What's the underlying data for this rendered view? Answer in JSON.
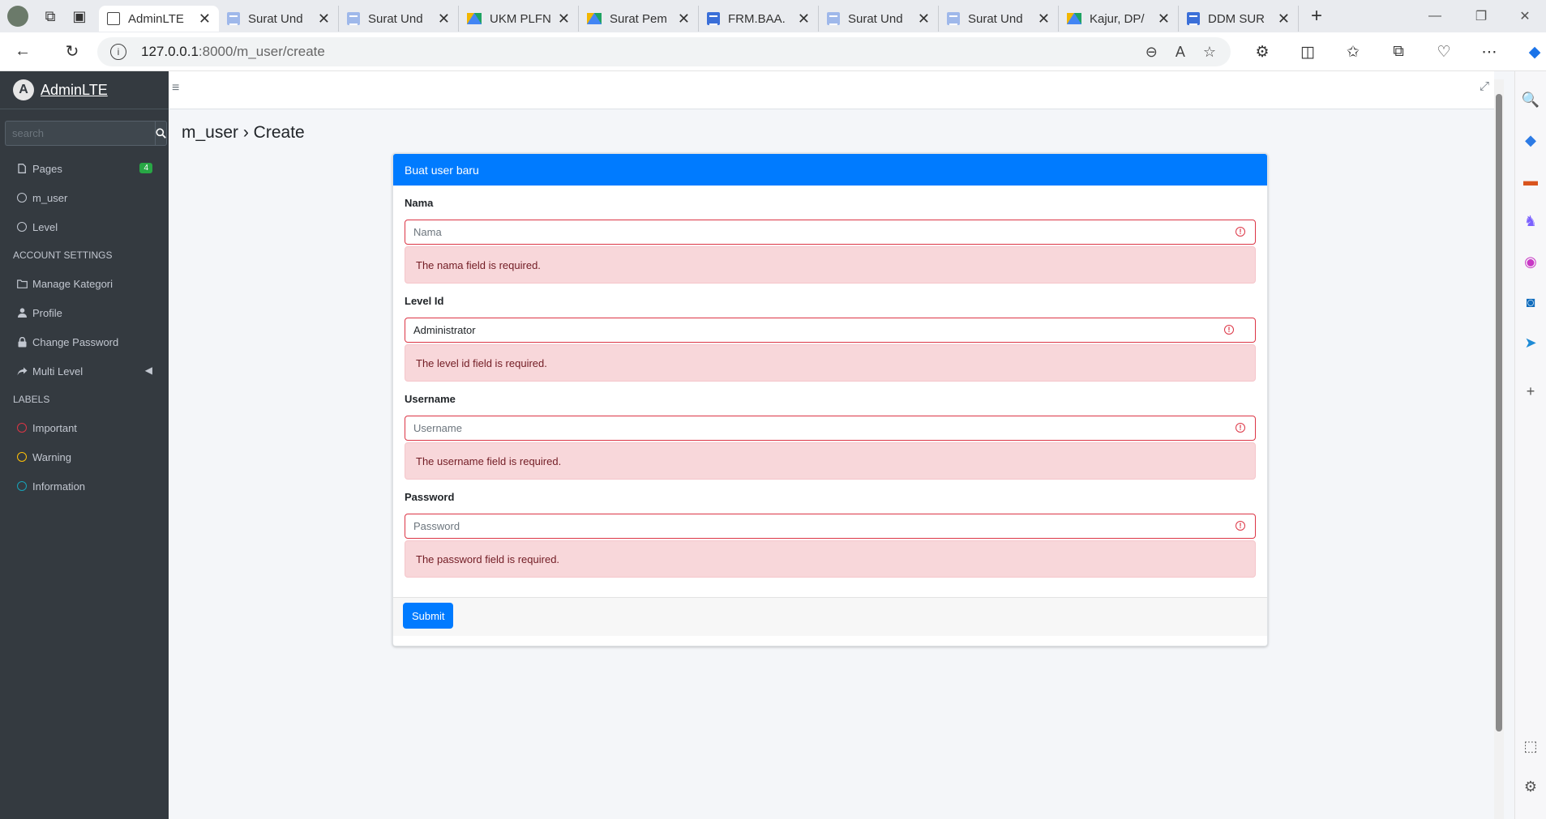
{
  "browser": {
    "tabs": [
      {
        "title": "AdminLTE",
        "icon": "page-icon",
        "active": true
      },
      {
        "title": "Surat Und",
        "icon": "docs-icon"
      },
      {
        "title": "Surat Und",
        "icon": "docs-icon"
      },
      {
        "title": "UKM PLFN",
        "icon": "drive-icon"
      },
      {
        "title": "Surat Pem",
        "icon": "drive-icon"
      },
      {
        "title": "FRM.BAA.",
        "icon": "docs-blue-icon"
      },
      {
        "title": "Surat Und",
        "icon": "docs-icon"
      },
      {
        "title": "Surat Und",
        "icon": "docs-icon"
      },
      {
        "title": "Kajur, DP/",
        "icon": "drive-icon"
      },
      {
        "title": "DDM SUR",
        "icon": "docs-blue-icon"
      }
    ],
    "url_host": "127.0.0.1",
    "url_path": ":8000/m_user/create"
  },
  "sidebar": {
    "brand_bold": "Admin",
    "brand_rest": "LTE",
    "brand_letter": "A",
    "search_placeholder": "search",
    "items": [
      {
        "label": "Pages",
        "badge": "4"
      },
      {
        "label": "m_user"
      },
      {
        "label": "Level"
      }
    ],
    "account_header": "ACCOUNT SETTINGS",
    "account_items": [
      {
        "label": "Manage Kategori"
      },
      {
        "label": "Profile"
      },
      {
        "label": "Change Password"
      },
      {
        "label": "Multi Level"
      }
    ],
    "labels_header": "LABELS",
    "label_items": [
      {
        "label": "Important",
        "color": "#dc3545"
      },
      {
        "label": "Warning",
        "color": "#ffc107"
      },
      {
        "label": "Information",
        "color": "#17a2b8"
      }
    ]
  },
  "content": {
    "breadcrumb_title": "m_user › Create",
    "card_title": "Buat user baru",
    "fields": [
      {
        "label": "Nama",
        "placeholder": "Nama",
        "value": "",
        "error": "The nama field is required."
      },
      {
        "label": "Level Id",
        "placeholder": "",
        "value": "Administrator",
        "error": "The level id field is required."
      },
      {
        "label": "Username",
        "placeholder": "Username",
        "value": "",
        "error": "The username field is required."
      },
      {
        "label": "Password",
        "placeholder": "Password",
        "value": "",
        "error": "The password field is required."
      }
    ],
    "submit_label": "Submit"
  },
  "colors": {
    "primary": "#007bff",
    "danger": "#dc3545",
    "sidebar_bg": "#343a40",
    "badge_green": "#28a745"
  }
}
